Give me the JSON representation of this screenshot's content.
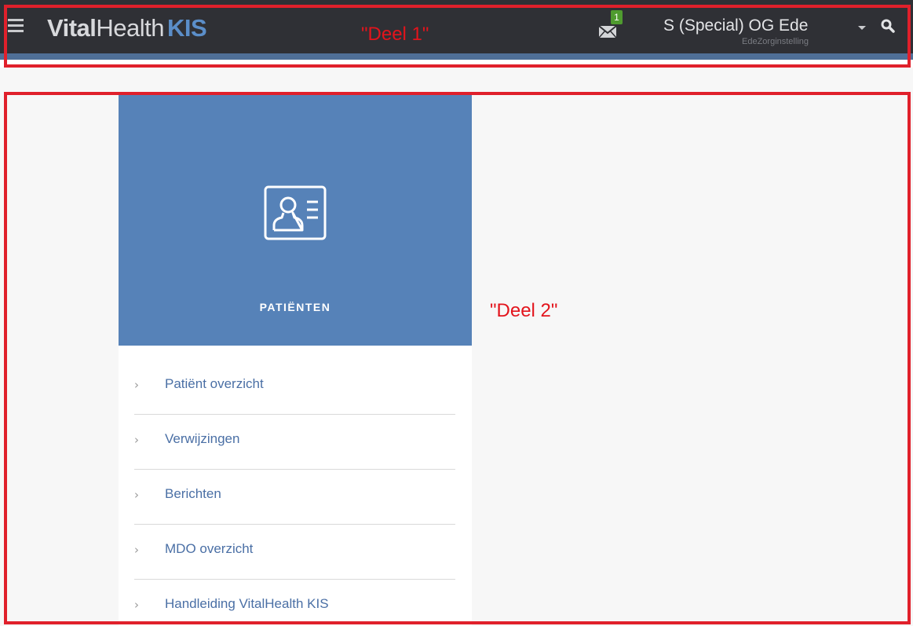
{
  "annotations": {
    "part1_label": "\"Deel 1\"",
    "part2_label": "\"Deel 2\""
  },
  "header": {
    "brand_part1": "Vital",
    "brand_part2": "Health",
    "brand_part3": "KIS",
    "mail_badge_count": "1",
    "user_name": "S (Special) OG Ede",
    "user_org": "EdeZorginstelling",
    "icons": {
      "menu": "hamburger-icon",
      "mail": "envelope-icon",
      "dropdown": "caret-down-icon",
      "search": "search-icon"
    }
  },
  "tile": {
    "title": "PATIËNTEN",
    "icon": "patient-card-icon"
  },
  "menu": {
    "items": [
      {
        "label": "Patiënt overzicht"
      },
      {
        "label": "Verwijzingen"
      },
      {
        "label": "Berichten"
      },
      {
        "label": "MDO overzicht"
      },
      {
        "label": "Handleiding VitalHealth KIS"
      }
    ]
  },
  "colors": {
    "header_bg": "#2f3035",
    "header_stripe": "#4f6f97",
    "brand_accent": "#5b8ec9",
    "tile_bg": "#5682b8",
    "link": "#4a6fa5",
    "badge": "#4f9b2f",
    "annotation": "#e0202b"
  }
}
